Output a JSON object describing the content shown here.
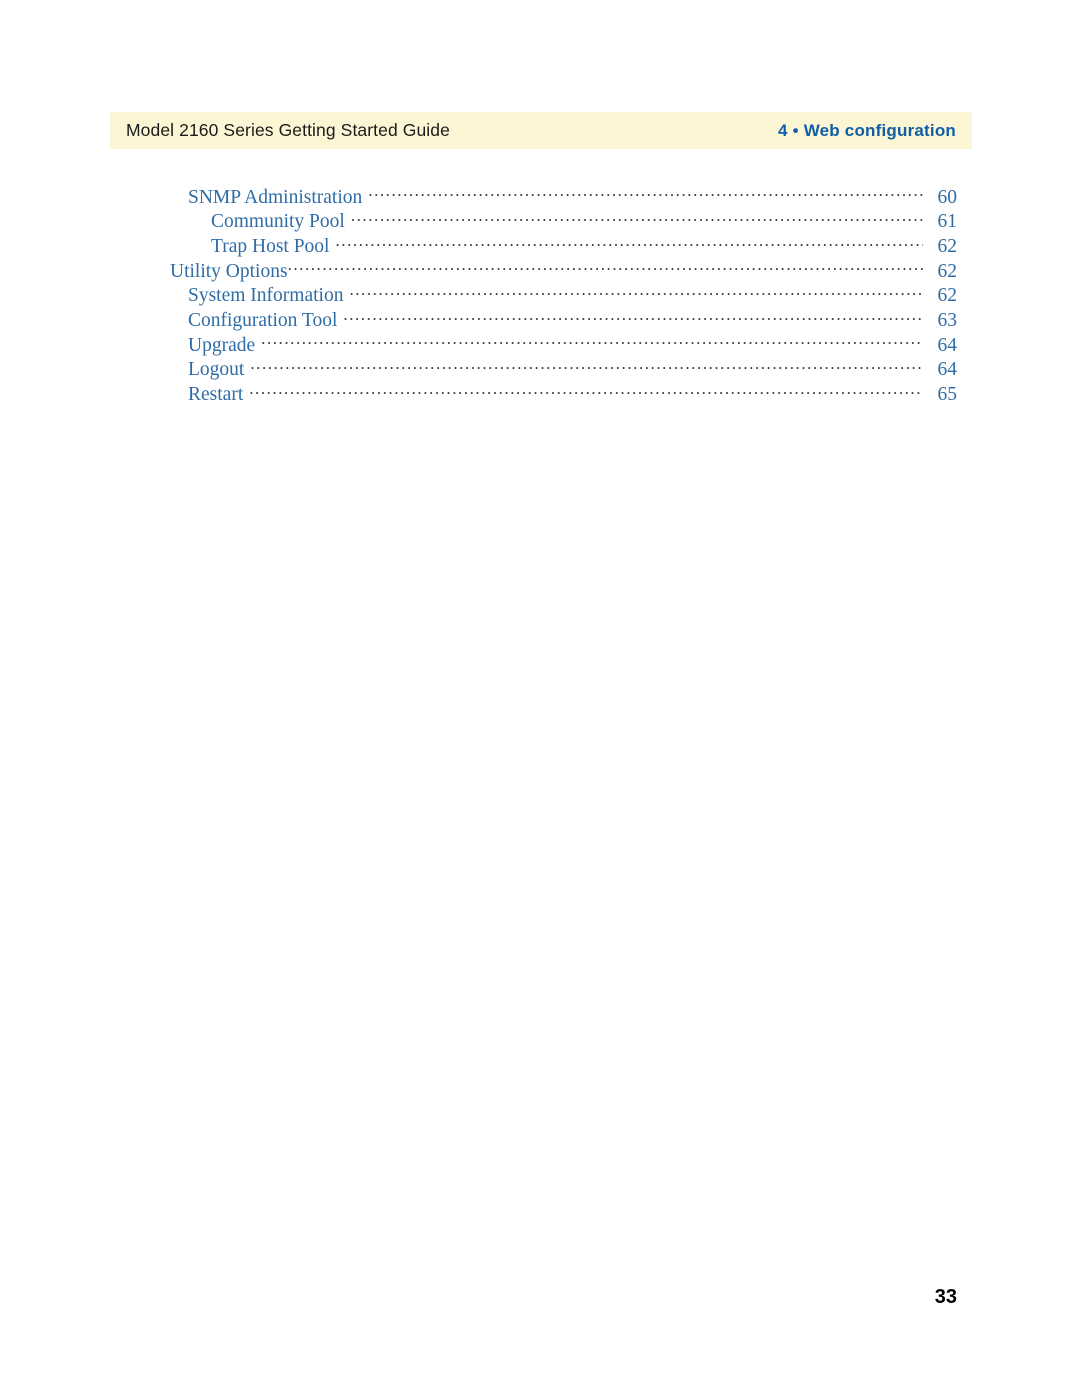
{
  "header": {
    "left_title": "Model 2160 Series Getting Started Guide",
    "right_title": "4 • Web configuration",
    "band_color": "#FDF6D5",
    "right_title_color": "#0F5FA8"
  },
  "toc": {
    "text_color": "#2F6CA6",
    "leader_color": "#3A3A3A",
    "entries": [
      {
        "label": "SNMP Administration",
        "page": "60",
        "level": 2,
        "gap_before_leader": true
      },
      {
        "label": "Community Pool",
        "page": "61",
        "level": 3,
        "gap_before_leader": true
      },
      {
        "label": "Trap Host Pool",
        "page": "62",
        "level": 3,
        "gap_before_leader": true
      },
      {
        "label": "Utility Options",
        "page": "62",
        "level": 1,
        "gap_before_leader": false
      },
      {
        "label": "System Information",
        "page": "62",
        "level": 2,
        "gap_before_leader": true
      },
      {
        "label": "Configuration Tool",
        "page": "63",
        "level": 2,
        "gap_before_leader": true
      },
      {
        "label": "Upgrade",
        "page": "64",
        "level": 2,
        "gap_before_leader": true
      },
      {
        "label": "Logout",
        "page": "64",
        "level": 2,
        "gap_before_leader": true
      },
      {
        "label": "Restart",
        "page": "65",
        "level": 2,
        "gap_before_leader": true
      }
    ]
  },
  "footer": {
    "page_number": "33"
  }
}
